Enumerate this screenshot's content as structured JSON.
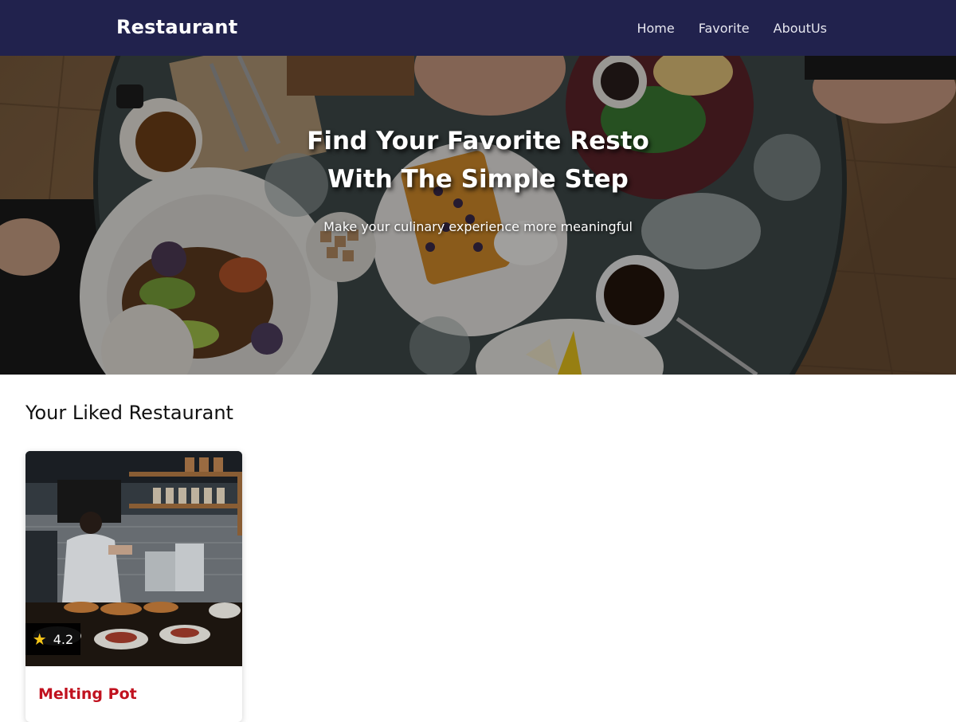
{
  "header": {
    "brand": "Restaurant",
    "nav": [
      "Home",
      "Favorite",
      "AboutUs"
    ]
  },
  "hero": {
    "title": "Find Your Favorite Resto With The Simple Step",
    "tagline": "Make your culinary experience more meaningful"
  },
  "main": {
    "section_title": "Your Liked Restaurant",
    "restaurants": [
      {
        "name": "Melting Pot",
        "rating": "4.2"
      }
    ]
  },
  "colors": {
    "header_bg": "#21224d",
    "title_red": "#c1121f",
    "star_gold": "#f5c518"
  },
  "icons": {
    "rating": "star-icon"
  }
}
